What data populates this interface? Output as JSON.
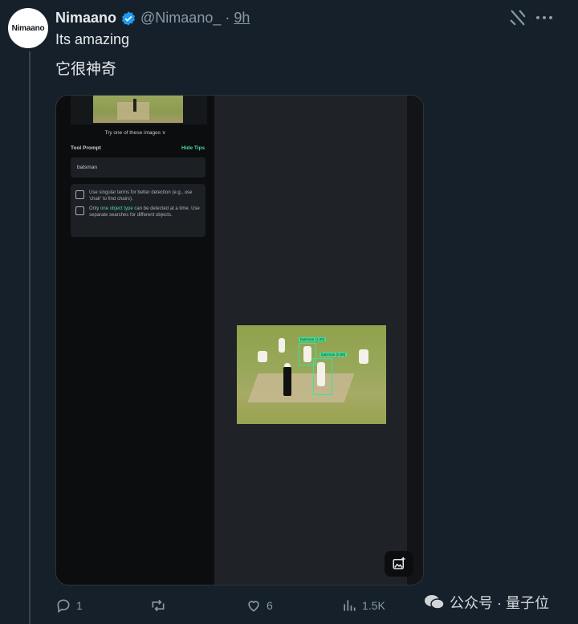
{
  "author": {
    "avatar_text": "Nimaano",
    "name": "Nimaano",
    "handle": "@Nimaano_",
    "separator": "·",
    "time": "9h"
  },
  "tweet": {
    "text_line1": "Its amazing",
    "text_line2": "它很神奇"
  },
  "media": {
    "try_label": "Try one of these images ∨",
    "tool_prompt_label": "Tool Prompt",
    "hide_tips": "Hide Tips",
    "prompt_value": "batsman",
    "tip1": "Use singular terms for better detection (e.g., use 'chair' to find chairs).",
    "tip2_prefix": "Only ",
    "tip2_accent": "one object type",
    "tip2_suffix": " can be detected at a time. Use separate searches for different objects.",
    "bbox_label_1": "batsman (1.00)",
    "bbox_label_2": "batsman (0.69)"
  },
  "actions": {
    "replies": "1",
    "reposts": "",
    "likes": "6",
    "views": "1.5K"
  },
  "watermark": {
    "text": "公众号 · 量子位"
  },
  "colors": {
    "background": "#15202b",
    "text_secondary": "#8b98a5",
    "verified_blue": "#1d9bf0",
    "accent_green": "#4dd6a3"
  },
  "icons": [
    "verified-badge-icon",
    "grok-icon",
    "more-icon",
    "image-icon",
    "reply-icon",
    "repost-icon",
    "like-icon",
    "views-icon",
    "wechat-icon",
    "share-icon"
  ]
}
